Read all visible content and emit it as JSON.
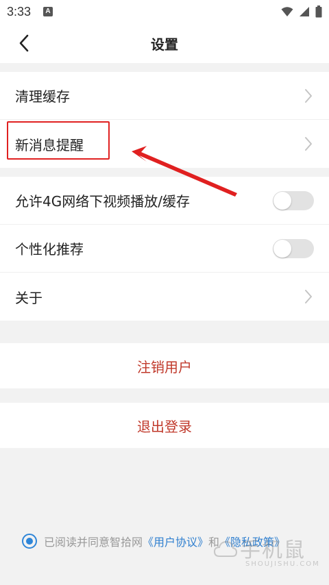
{
  "status_bar": {
    "time": "3:33",
    "notification_letter": "A",
    "icons": [
      "wifi-icon",
      "signal-icon",
      "battery-icon"
    ]
  },
  "header": {
    "title": "设置",
    "back_icon": "chevron-left-icon"
  },
  "group1": {
    "items": [
      {
        "label": "清理缓存",
        "icon": "chevron-right-icon"
      },
      {
        "label": "新消息提醒",
        "icon": "chevron-right-icon"
      }
    ]
  },
  "group2": {
    "items": [
      {
        "label": "允许4G网络下视频播放/缓存",
        "toggle_on": false
      },
      {
        "label": "个性化推荐",
        "toggle_on": false
      },
      {
        "label": "关于",
        "icon": "chevron-right-icon"
      }
    ]
  },
  "actions": {
    "cancel_account": "注销用户",
    "logout": "退出登录"
  },
  "agreement": {
    "checked": true,
    "prefix": "已阅读并同意智拾网",
    "user_agreement": "《用户协议》",
    "conjunction": "和",
    "privacy_policy": "《隐私政策》"
  },
  "watermark": {
    "text": "手机鼠",
    "subtext": "SHOUJISHU.COM"
  },
  "colors": {
    "background": "#f2f2f2",
    "accent_red": "#c0392b",
    "link_blue": "#2f7fcf",
    "annotation_red": "#e02020",
    "toggle_off": "#e2e2e2"
  }
}
